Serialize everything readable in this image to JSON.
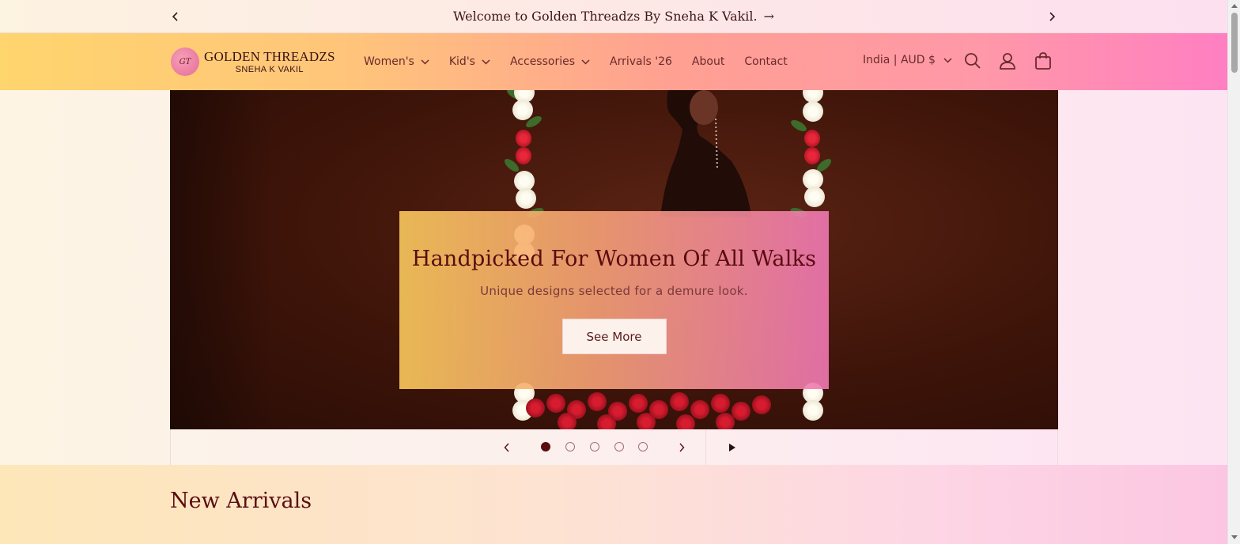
{
  "announcement": {
    "message": "Welcome to Golden Threadzs By Sneha K Vakil.",
    "arrow": "→",
    "prev_icon": "chevron-left-icon",
    "next_icon": "chevron-right-icon"
  },
  "header": {
    "logo": {
      "monogram": "GT",
      "line1": "GOLDEN THREADZS",
      "line2": "SNEHA K VAKIL"
    },
    "nav": [
      {
        "label": "Women's",
        "has_dropdown": true
      },
      {
        "label": "Kid's",
        "has_dropdown": true
      },
      {
        "label": "Accessories",
        "has_dropdown": true
      },
      {
        "label": "Arrivals '26",
        "has_dropdown": false
      },
      {
        "label": "About",
        "has_dropdown": false
      },
      {
        "label": "Contact",
        "has_dropdown": false
      }
    ],
    "locale": "India | AUD $",
    "icons": [
      "search-icon",
      "account-icon",
      "cart-icon"
    ]
  },
  "hero": {
    "title": "Handpicked For Women Of All Walks",
    "subtitle": "Unique designs selected for a demure look.",
    "button": "See More"
  },
  "slider": {
    "slide_count": 5,
    "active_index": 0,
    "controls": [
      "prev-icon",
      "next-icon",
      "play-icon"
    ]
  },
  "section": {
    "title": "New Arrivals"
  },
  "colors": {
    "brand_dark": "#5a0c10",
    "header_gradient_start": "#ffd56e",
    "header_gradient_end": "#ff7fc2"
  }
}
